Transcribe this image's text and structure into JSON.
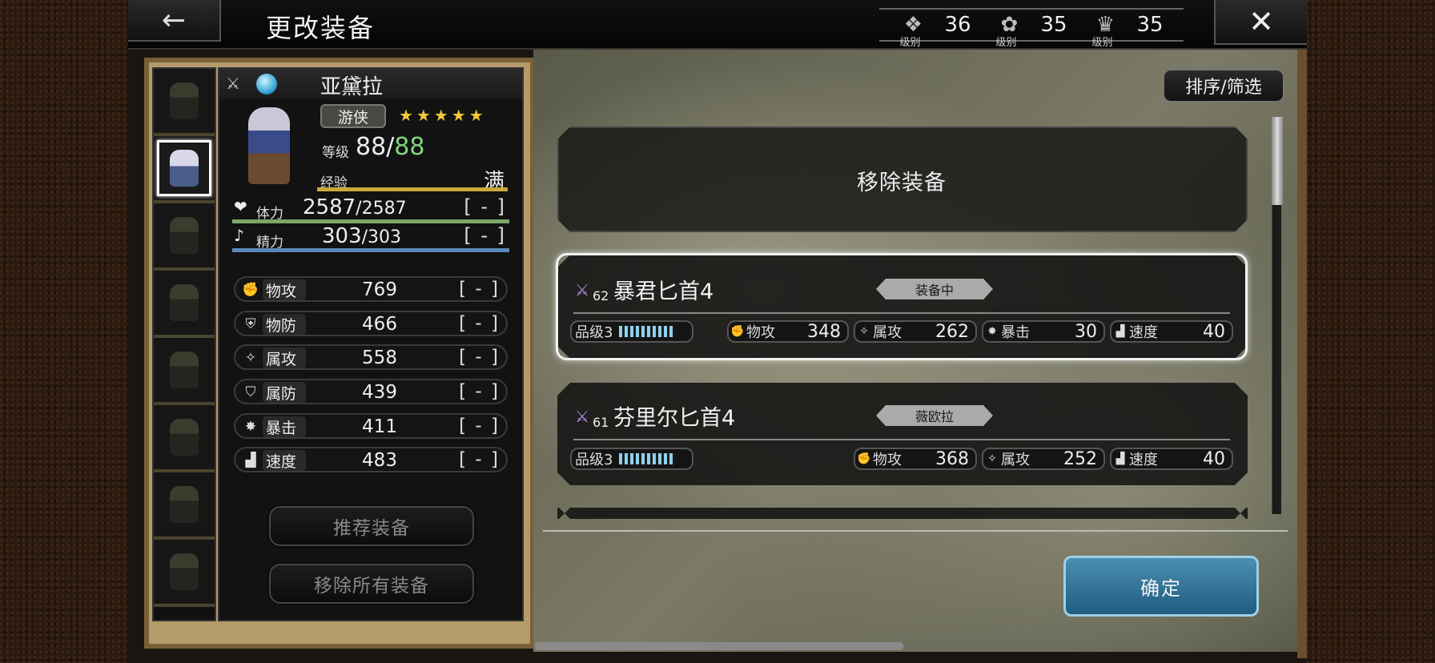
{
  "header": {
    "title": "更改装备",
    "back_icon": "←",
    "close_icon": "✕",
    "levels": [
      {
        "icon": "crystal-icon",
        "glyph": "❖",
        "tag": "级别",
        "value": "36"
      },
      {
        "icon": "lotus-icon",
        "glyph": "✿",
        "tag": "级别",
        "value": "35"
      },
      {
        "icon": "crown-icon",
        "glyph": "♛",
        "tag": "级别",
        "value": "35"
      }
    ]
  },
  "character": {
    "name": "亚黛拉",
    "job": "游侠",
    "stars": "★★★★★",
    "level_label": "等级",
    "level": "88",
    "level_sep": "/",
    "level_max": "88",
    "exp_label": "经验",
    "exp_value": "满",
    "hp": {
      "label": "体力",
      "current": "2587",
      "max": "/2587",
      "bonus": "[ - ]"
    },
    "mp": {
      "label": "精力",
      "current": "303",
      "max": "/303",
      "bonus": "[ - ]"
    },
    "stats": [
      {
        "icon": "fist-icon",
        "glyph": "✊",
        "label": "物攻",
        "value": "769",
        "bonus": "[ - ]"
      },
      {
        "icon": "shield-icon",
        "glyph": "⛨",
        "label": "物防",
        "value": "466",
        "bonus": "[ - ]"
      },
      {
        "icon": "magic-icon",
        "glyph": "✧",
        "label": "属攻",
        "value": "558",
        "bonus": "[ - ]"
      },
      {
        "icon": "magic-shield-icon",
        "glyph": "⛉",
        "label": "属防",
        "value": "439",
        "bonus": "[ - ]"
      },
      {
        "icon": "crit-icon",
        "glyph": "✸",
        "label": "暴击",
        "value": "411",
        "bonus": "[ - ]"
      },
      {
        "icon": "boot-icon",
        "glyph": "▟",
        "label": "速度",
        "value": "483",
        "bonus": "[ - ]"
      }
    ],
    "recommend_button": "推荐装备",
    "remove_all_button": "移除所有装备"
  },
  "equipment": {
    "sort_button": "排序/筛选",
    "remove_label": "移除装备",
    "items": [
      {
        "level": "62",
        "name": "暴君匕首4",
        "status": "装备中",
        "grade_label": "品级3",
        "stats": [
          {
            "icon": "fist-icon",
            "glyph": "✊",
            "label": "物攻",
            "value": "348"
          },
          {
            "icon": "magic-icon",
            "glyph": "✧",
            "label": "属攻",
            "value": "262"
          },
          {
            "icon": "crit-icon",
            "glyph": "✸",
            "label": "暴击",
            "value": "30"
          },
          {
            "icon": "boot-icon",
            "glyph": "▟",
            "label": "速度",
            "value": "40"
          }
        ]
      },
      {
        "level": "61",
        "name": "芬里尔匕首4",
        "status": "薇欧拉",
        "grade_label": "品级3",
        "stats": [
          {
            "icon": "fist-icon",
            "glyph": "✊",
            "label": "物攻",
            "value": "368"
          },
          {
            "icon": "magic-icon",
            "glyph": "✧",
            "label": "属攻",
            "value": "252"
          },
          {
            "icon": "boot-icon",
            "glyph": "▟",
            "label": "速度",
            "value": "40"
          }
        ]
      }
    ],
    "confirm_button": "确定"
  }
}
